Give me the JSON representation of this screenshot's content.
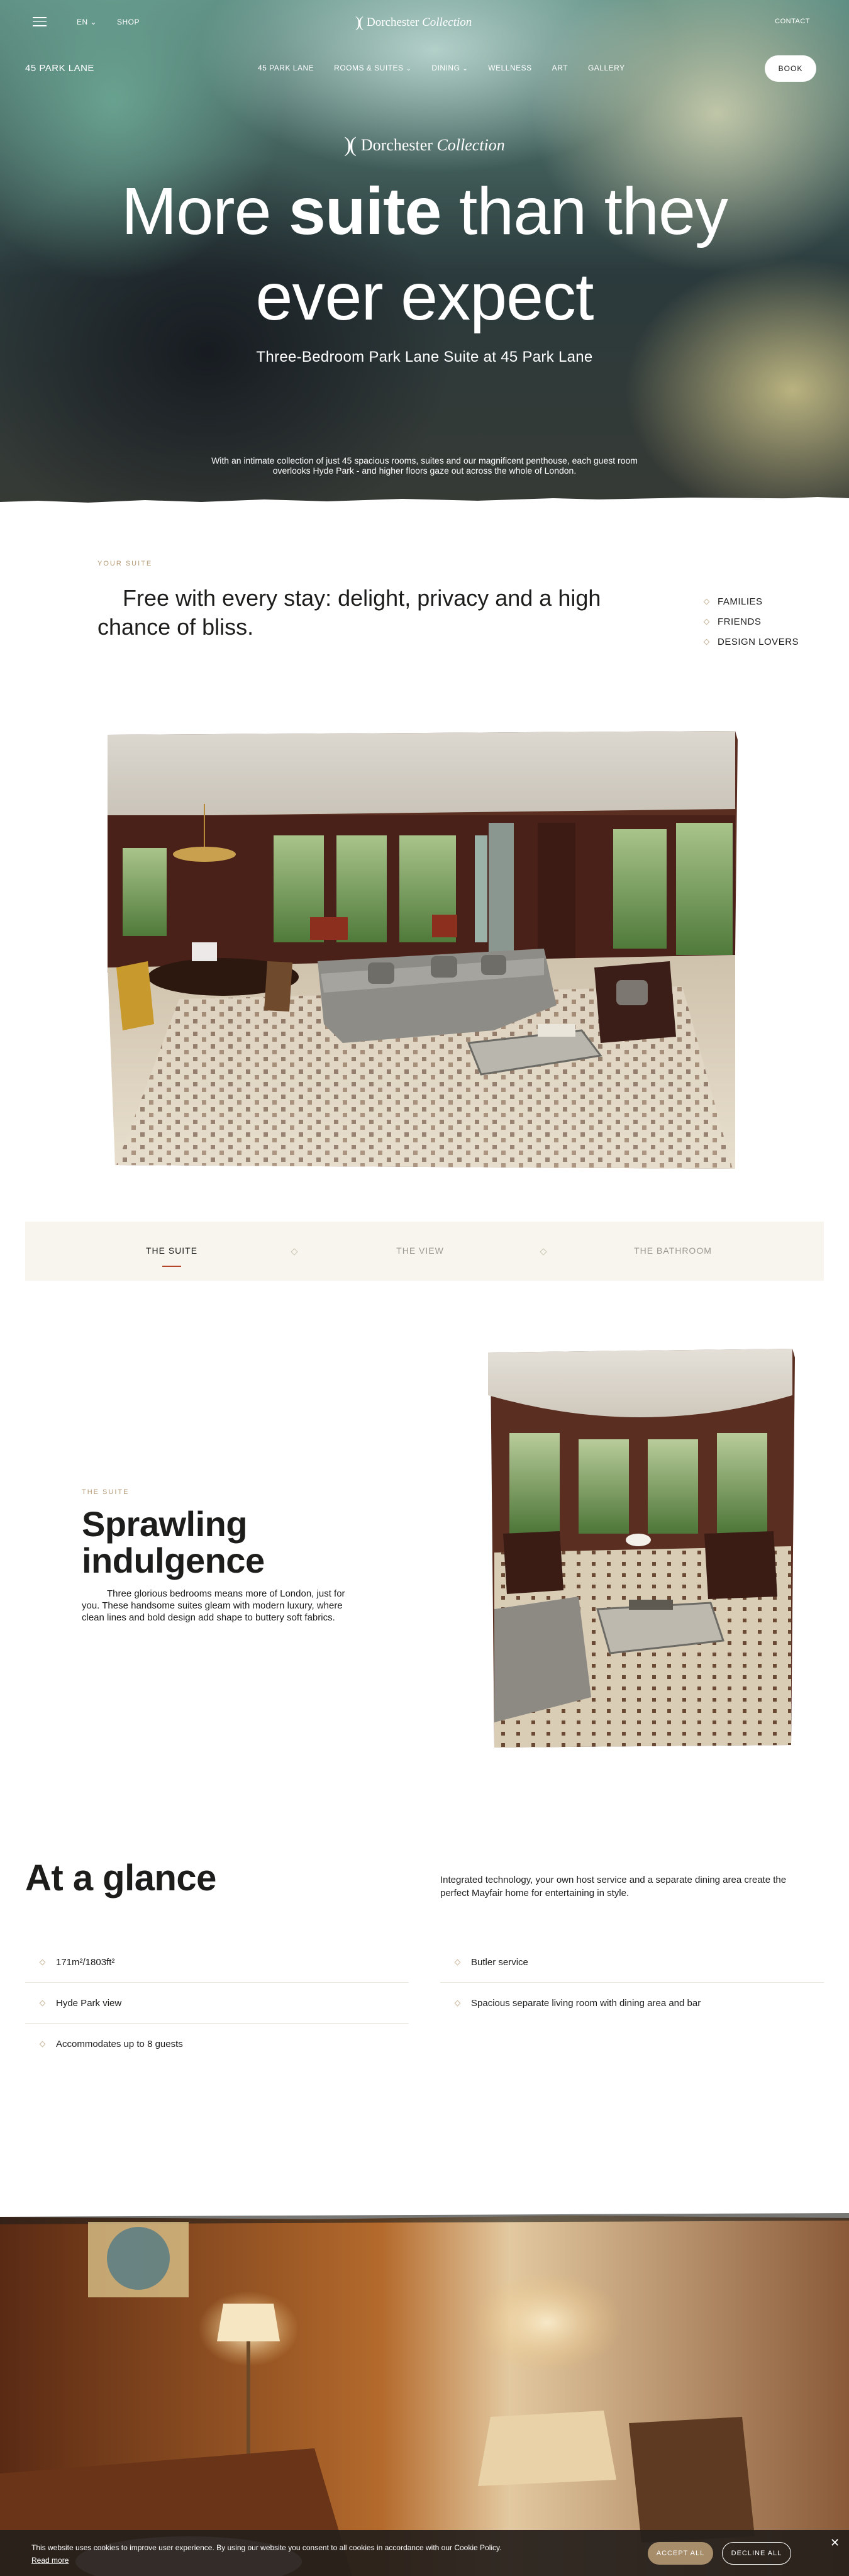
{
  "header": {
    "menu_icon": "hamburger-menu-icon",
    "language": "EN",
    "shop": "SHOP",
    "brand": {
      "name": "Dorchester",
      "italic": "Collection"
    },
    "contact": "CONTACT"
  },
  "nav": {
    "property_name": "45 PARK LANE",
    "items": [
      {
        "label": "45 PARK LANE",
        "has_dropdown": false
      },
      {
        "label": "ROOMS & SUITES",
        "has_dropdown": true
      },
      {
        "label": "DINING",
        "has_dropdown": true
      },
      {
        "label": "WELLNESS",
        "has_dropdown": false
      },
      {
        "label": "ART",
        "has_dropdown": false
      },
      {
        "label": "GALLERY",
        "has_dropdown": false
      }
    ],
    "book": "BOOK"
  },
  "hero": {
    "brand": {
      "name": "Dorchester",
      "italic": "Collection"
    },
    "title_part1": "More ",
    "title_bold": "suite",
    "title_part2": " than they",
    "title_line2": "ever expect",
    "subtitle": "Three-Bedroom Park Lane Suite at 45 Park Lane",
    "body": "With an intimate collection of just 45 spacious rooms, suites and our magnificent penthouse, each guest room overlooks Hyde Park - and higher floors gaze out across the whole of London."
  },
  "intro": {
    "eyebrow": "YOUR SUITE",
    "text": "Free with every stay: delight, privacy and a high chance of bliss.",
    "tags": [
      "FAMILIES",
      "FRIENDS",
      "DESIGN LOVERS"
    ]
  },
  "tabs": [
    {
      "label": "THE SUITE",
      "active": true
    },
    {
      "label": "THE VIEW",
      "active": false
    },
    {
      "label": "THE BATHROOM",
      "active": false
    }
  ],
  "suite": {
    "eyebrow": "THE SUITE",
    "title": "Sprawling indulgence",
    "body": "Three glorious bedrooms means more of London, just for you. These handsome suites gleam with modern luxury, where clean lines and bold design add shape to buttery soft fabrics."
  },
  "glance": {
    "title": "At a glance",
    "description": "Integrated technology, your own host service and a separate dining area create the perfect Mayfair home for entertaining in style.",
    "left": [
      "171m²/1803ft²",
      "Hyde Park view",
      "Accommodates up to 8 guests"
    ],
    "right": [
      "Butler service",
      "Spacious separate living room with dining area and bar"
    ]
  },
  "cookie": {
    "text": "This website uses cookies to improve user experience. By using our website you consent to all cookies in accordance with our Cookie Policy.",
    "read_more": "Read more",
    "accept": "ACCEPT ALL",
    "decline": "DECLINE ALL",
    "close": "✕"
  }
}
